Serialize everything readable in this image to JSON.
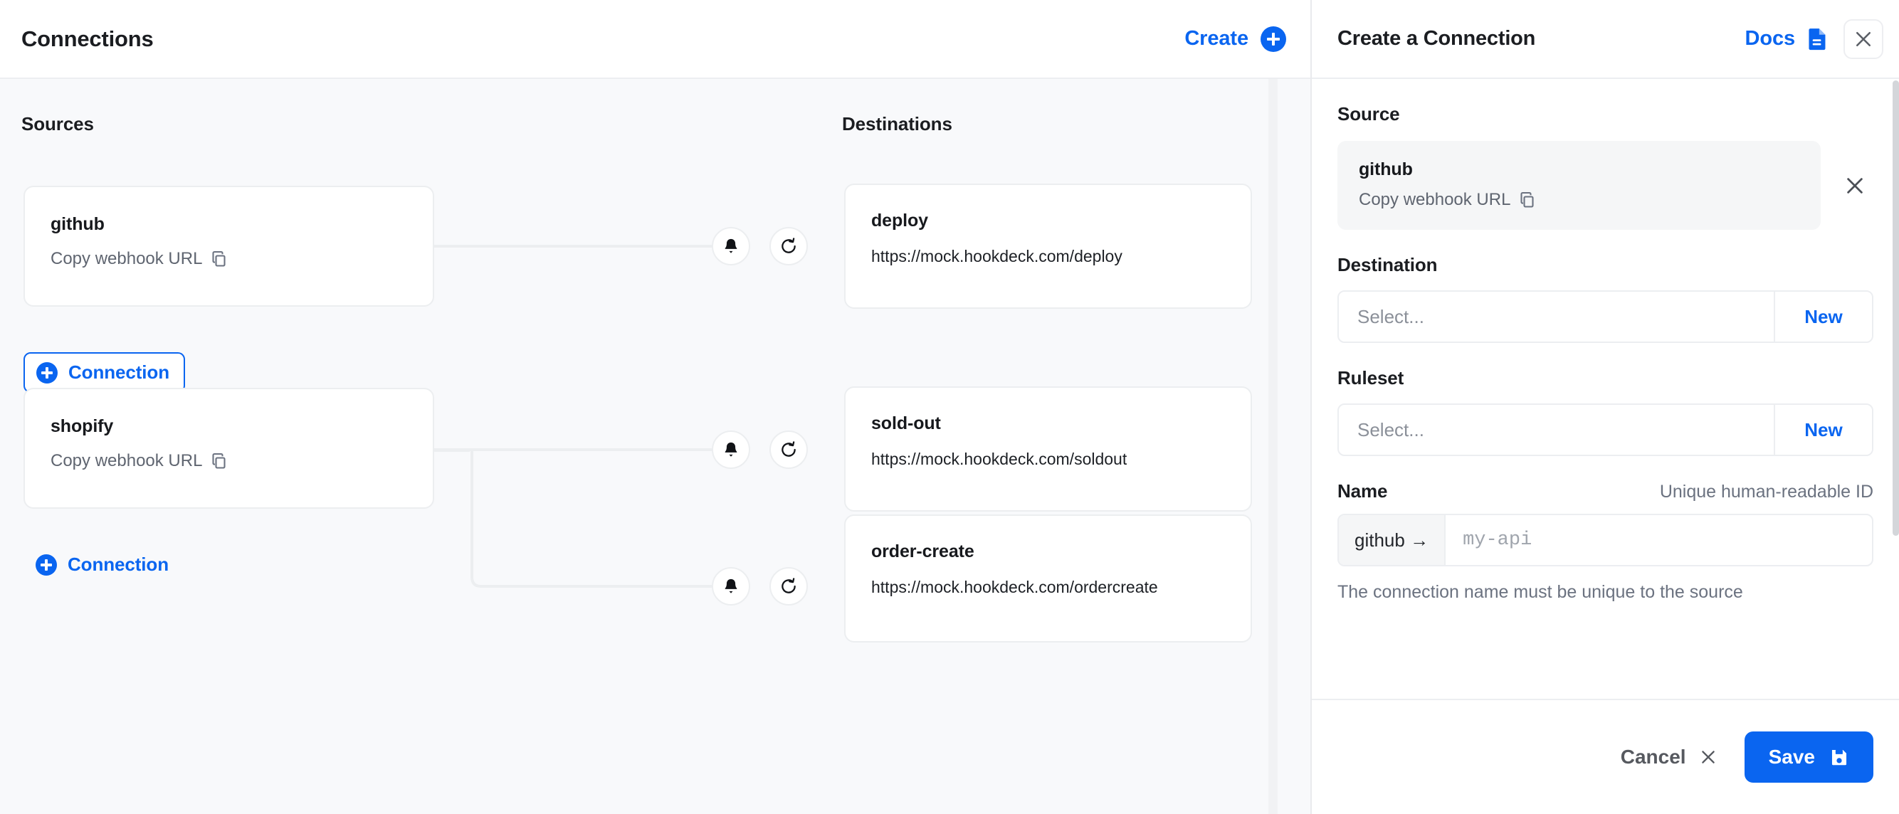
{
  "left": {
    "title": "Connections",
    "create_label": "Create",
    "sources_label": "Sources",
    "destinations_label": "Destinations",
    "copy_webhook_label": "Copy webhook URL",
    "connection_label": "Connection",
    "sources": [
      {
        "name": "github",
        "copy_label": "Copy webhook URL"
      },
      {
        "name": "shopify",
        "copy_label": "Copy webhook URL"
      }
    ],
    "destinations": [
      {
        "name": "deploy",
        "url": "https://mock.hookdeck.com/deploy"
      },
      {
        "name": "sold-out",
        "url": "https://mock.hookdeck.com/soldout"
      },
      {
        "name": "order-create",
        "url": "https://mock.hookdeck.com/ordercreate"
      }
    ],
    "add_connection_buttons": [
      {
        "label": "Connection",
        "style": "boxed"
      },
      {
        "label": "Connection",
        "style": "plain"
      }
    ]
  },
  "panel": {
    "title": "Create a Connection",
    "docs_label": "Docs",
    "source": {
      "label": "Source",
      "name": "github",
      "copy_label": "Copy webhook URL"
    },
    "destination": {
      "label": "Destination",
      "placeholder": "Select...",
      "value": "",
      "new_label": "New"
    },
    "ruleset": {
      "label": "Ruleset",
      "placeholder": "Select...",
      "value": "",
      "new_label": "New"
    },
    "name": {
      "label": "Name",
      "hint": "Unique human-readable ID",
      "prefix": "github →",
      "placeholder": "my-api",
      "value": "",
      "helper": "The connection name must be unique to the source"
    },
    "footer": {
      "cancel_label": "Cancel",
      "save_label": "Save"
    }
  },
  "colors": {
    "accent": "#0a65f0",
    "canvas_bg": "#f8f9fb",
    "border": "#eceef1",
    "muted_text": "#6b7280"
  }
}
